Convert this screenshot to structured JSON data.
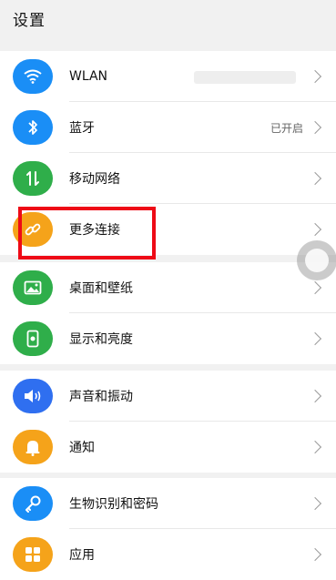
{
  "header": {
    "title": "设置"
  },
  "groups": [
    {
      "items": [
        {
          "label": "WLAN",
          "status": "",
          "icon": "wifi-icon",
          "color": "#1a8ef6"
        },
        {
          "label": "蓝牙",
          "status": "已开启",
          "icon": "bluetooth-icon",
          "color": "#1a8ef6"
        },
        {
          "label": "移动网络",
          "status": "",
          "icon": "mobile-data-icon",
          "color": "#2fae4a"
        },
        {
          "label": "更多连接",
          "status": "",
          "icon": "link-icon",
          "color": "#f5a31a"
        }
      ]
    },
    {
      "items": [
        {
          "label": "桌面和壁纸",
          "icon": "wallpaper-icon",
          "color": "#2fae4a"
        },
        {
          "label": "显示和亮度",
          "icon": "display-icon",
          "color": "#2fae4a"
        }
      ]
    },
    {
      "items": [
        {
          "label": "声音和振动",
          "icon": "sound-icon",
          "color": "#2f6ff0"
        },
        {
          "label": "通知",
          "icon": "bell-icon",
          "color": "#f5a31a"
        }
      ]
    },
    {
      "items": [
        {
          "label": "生物识别和密码",
          "icon": "key-icon",
          "color": "#1a8ef6"
        },
        {
          "label": "应用",
          "icon": "apps-icon",
          "color": "#f5a31a"
        }
      ]
    }
  ],
  "highlight_color": "#ee0a16"
}
